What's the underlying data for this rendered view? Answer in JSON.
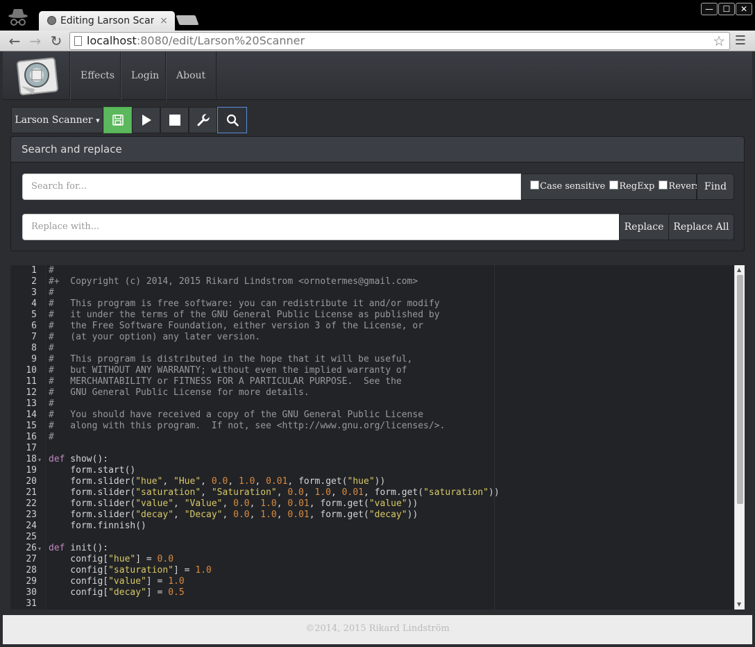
{
  "browser": {
    "tab_title": "Editing Larson Scanner",
    "tab_close": "×",
    "url_host": "localhost",
    "url_rest": ":8080/edit/Larson%20Scanner",
    "window_controls": [
      "—",
      "☐",
      "✕"
    ]
  },
  "nav": {
    "items": [
      "Effects",
      "Login",
      "About"
    ]
  },
  "toolbar": {
    "effect_name": "Larson Scanner",
    "effect_caret": "▾",
    "icons": [
      "save-icon",
      "play-icon",
      "stop-icon",
      "wrench-icon",
      "search-icon"
    ]
  },
  "search_panel": {
    "title": "Search and replace",
    "search_placeholder": "Search for...",
    "replace_placeholder": "Replace with...",
    "options": [
      "Case sensitive",
      "RegExp",
      "Reverse"
    ],
    "find_label": "Find",
    "replace_label": "Replace",
    "replace_all_label": "Replace All"
  },
  "code": {
    "line_numbers": [
      "1",
      "2",
      "3",
      "4",
      "5",
      "6",
      "7",
      "8",
      "9",
      "10",
      "11",
      "12",
      "13",
      "14",
      "15",
      "16",
      "17",
      "18",
      "19",
      "20",
      "21",
      "22",
      "23",
      "24",
      "25",
      "26",
      "27",
      "28",
      "29",
      "30",
      "31"
    ],
    "fold_lines": [
      "18",
      "26"
    ]
  },
  "footer": {
    "text": "©2014, 2015 Rikard Lindström"
  },
  "colors": {
    "accent_save": "#5cb85c",
    "active_border": "#5a8fd8",
    "keyword": "#c188c1",
    "string": "#d8c965",
    "number": "#d88b3f",
    "comment": "#9a9a9a"
  }
}
